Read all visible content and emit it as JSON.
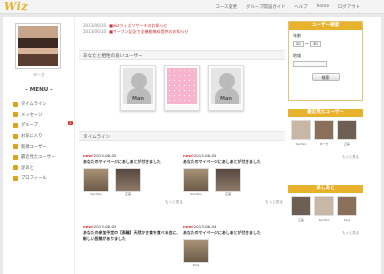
{
  "brand": {
    "logo": "Wiz",
    "accent": "#e9b22c"
  },
  "topnav": [
    "コース変更",
    "グループ開設ガイド",
    "ヘルプ",
    "home",
    "ログアウト"
  ],
  "user": {
    "name": "ゆーき"
  },
  "menu": {
    "title": "- MENU -",
    "items": [
      {
        "label": "タイムライン",
        "icon": "clock-icon"
      },
      {
        "label": "メッセージ",
        "icon": "message-icon"
      },
      {
        "label": "グループ",
        "icon": "group-icon",
        "badge": "2"
      },
      {
        "label": "お気に入り",
        "icon": "star-icon"
      },
      {
        "label": "新規ユーザー",
        "icon": "new-user-icon"
      },
      {
        "label": "最近見たユーザー",
        "icon": "history-icon"
      },
      {
        "label": "足あと",
        "icon": "footprint-icon"
      },
      {
        "label": "プロフィール",
        "icon": "profile-icon"
      }
    ]
  },
  "notices": [
    {
      "date": "2013/06/10",
      "text": "■wizウィズリサーチのお知らせ"
    },
    {
      "date": "2013/06/10",
      "text": "■サーブン記念で全機能無料提供のお知らせ"
    }
  ],
  "recommend": {
    "heading": "あなたと相性の良いユーザー",
    "cards": [
      "Man",
      "",
      "Man"
    ]
  },
  "timeline": {
    "heading": "タイムライン",
    "posts": [
      {
        "tag": "new!",
        "date": "2013-06-05",
        "title": "あなたのマイページにあしあとが付きました",
        "thumbs": [
          "Sachiko",
          "正美"
        ]
      },
      {
        "tag": "new!",
        "date": "2013-06-05",
        "title": "あなたのマイページにあしあとが付きました",
        "thumbs": [
          "Sachiko",
          "正美"
        ]
      },
      {
        "tag": "new!",
        "date": "2013-06-05",
        "title": "あなたの参加予定の【高輪】天然かき食を食べる会に、新しい投稿がありました",
        "thumbs": []
      },
      {
        "tag": "new!",
        "date": "2013-06-04",
        "title": "あなたのマイページにあしあとが付きました",
        "thumbs": [
          "King"
        ]
      }
    ],
    "more_label": "もっと見る"
  },
  "search": {
    "title": "ユーザー検索",
    "age_label": "年齢",
    "age_from": "20",
    "age_to": "30",
    "area_label": "地域",
    "button": "検索"
  },
  "recent": {
    "title": "最近見たユーザー",
    "users": [
      "Sachiko",
      "ゆーき",
      "正美"
    ],
    "more": "もっと見る"
  },
  "favorites": {
    "title": "あしあと",
    "users": [
      "正美",
      "Sachiko",
      "King"
    ],
    "more": "もっと見る"
  }
}
